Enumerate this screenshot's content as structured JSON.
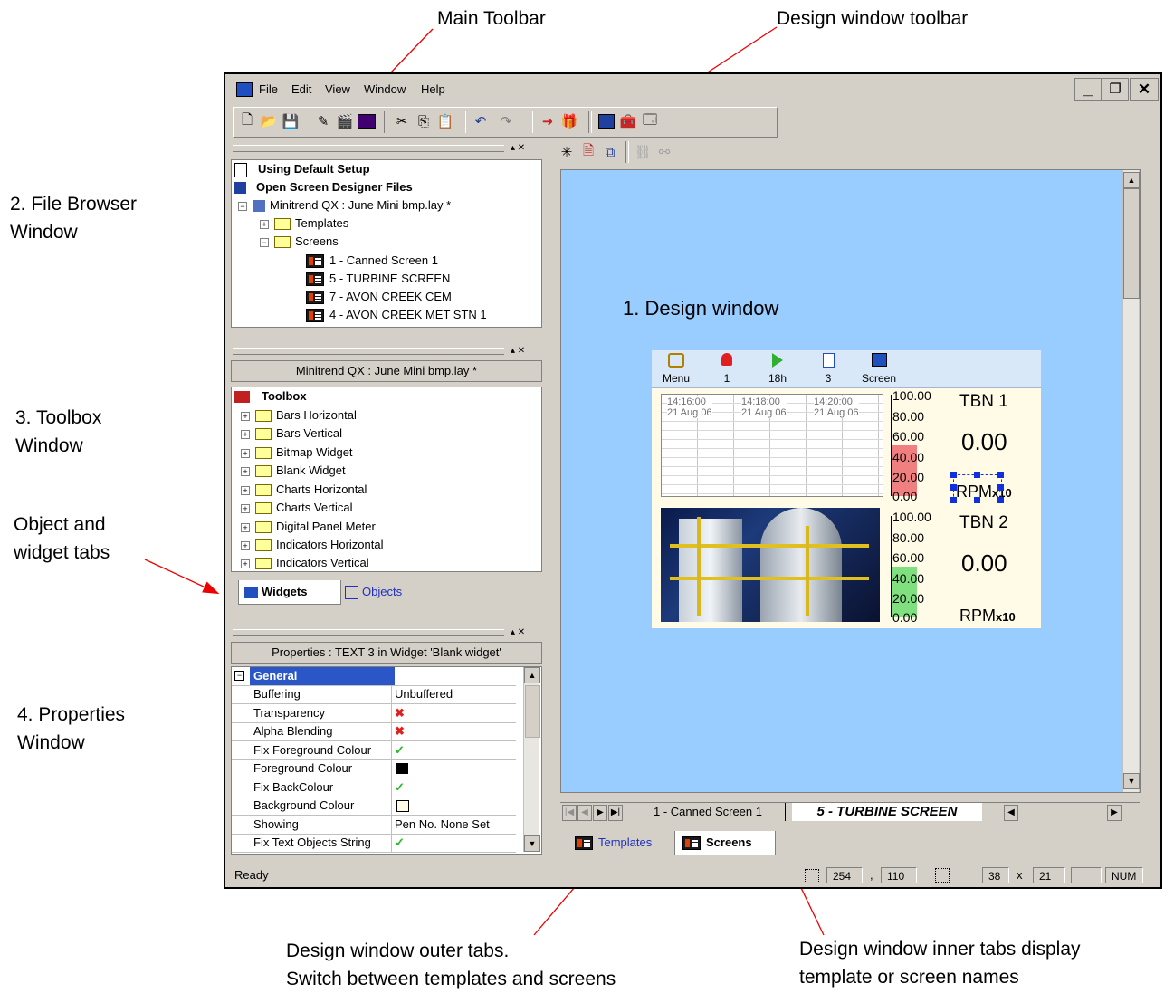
{
  "callouts": {
    "main_toolbar": "Main Toolbar",
    "design_window_toolbar": "Design window toolbar",
    "file_browser": [
      "2. File Browser",
      "Window"
    ],
    "toolbox": [
      "3. Toolbox",
      "Window"
    ],
    "object_widget_tabs": [
      "Object and",
      "widget tabs"
    ],
    "properties": [
      "4. Properties",
      "Window"
    ],
    "outer_tabs": [
      "Design window outer tabs.",
      "Switch between templates and screens"
    ],
    "inner_tabs": [
      "Design window inner tabs display",
      "template or screen names"
    ]
  },
  "menu": [
    "File",
    "Edit",
    "View",
    "Window",
    "Help"
  ],
  "window_controls": {
    "minimize": "_",
    "restore": "❐",
    "close": "✕"
  },
  "file_browser": {
    "items": [
      {
        "label": "Using Default Setup"
      },
      {
        "label": "Open Screen Designer Files"
      },
      {
        "label": "Minitrend QX : June Mini bmp.lay *"
      },
      {
        "label": "Templates"
      },
      {
        "label": "Screens"
      },
      {
        "label": "1 - Canned Screen 1"
      },
      {
        "label": "5 - TURBINE SCREEN"
      },
      {
        "label": "7 - AVON CREEK CEM"
      },
      {
        "label": "4 - AVON CREEK MET STN 1"
      }
    ]
  },
  "toolbox": {
    "header": "Minitrend QX : June Mini bmp.lay *",
    "root": "Toolbox",
    "items": [
      "Bars Horizontal",
      "Bars Vertical",
      "Bitmap Widget",
      "Blank Widget",
      "Charts Horizontal",
      "Charts Vertical",
      "Digital Panel Meter",
      "Indicators Horizontal",
      "Indicators Vertical"
    ],
    "tabs": {
      "widgets": "Widgets",
      "objects": "Objects"
    }
  },
  "properties": {
    "header": "Properties : TEXT 3 in Widget 'Blank widget'",
    "group": "General",
    "rows": [
      {
        "key": "Buffering",
        "value": "Unbuffered"
      },
      {
        "key": "Transparency",
        "value": "✖"
      },
      {
        "key": "Alpha Blending",
        "value": "✖"
      },
      {
        "key": "Fix Foreground Colour",
        "value": "✓"
      },
      {
        "key": "Foreground Colour",
        "value": ""
      },
      {
        "key": "Fix BackColour",
        "value": "✓"
      },
      {
        "key": "Background Colour",
        "value": ""
      },
      {
        "key": "Showing",
        "value": "Pen No. None Set"
      },
      {
        "key": "Fix Text Objects String",
        "value": "✓"
      }
    ]
  },
  "design": {
    "title": "1. Design window",
    "widget_buttons": [
      {
        "label": "Menu"
      },
      {
        "label": "1"
      },
      {
        "label": "18h"
      },
      {
        "label": "3"
      },
      {
        "label": "Screen"
      }
    ],
    "chart_times": [
      "14:16:00",
      "14:18:00",
      "14:20:00"
    ],
    "chart_date": "21 Aug 06",
    "scale_ticks": [
      "100.00",
      "80.00",
      "60.00",
      "40.00",
      "20.00",
      "0.00"
    ],
    "bar1_fraction": 0.5,
    "bar2_fraction": 0.5,
    "tbn1": {
      "name": "TBN 1",
      "value": "0.00",
      "unit": "RPM",
      "unit_suffix": "x10"
    },
    "tbn2": {
      "name": "TBN 2",
      "value": "0.00",
      "unit": "RPM",
      "unit_suffix": "x10"
    }
  },
  "inner_tabs": [
    "1 - Canned Screen 1",
    "5 - TURBINE SCREEN"
  ],
  "outer_tabs": [
    "Templates",
    "Screens"
  ],
  "status": {
    "text": "Ready",
    "x": "254",
    "y": "110",
    "w": "38",
    "h": "21",
    "sep1": ",",
    "sep2": "x",
    "num": "NUM"
  }
}
